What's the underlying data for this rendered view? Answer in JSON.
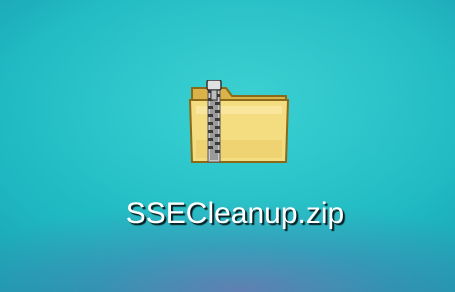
{
  "desktop": {
    "icons": [
      {
        "label": "SSECleanup.zip",
        "icon": "zip-folder-icon"
      }
    ]
  },
  "colors": {
    "desktop_background": "#1fb9c2",
    "folder_fill": "#f2d778",
    "folder_edge": "#8a6a18",
    "label_text": "#ffffff"
  }
}
